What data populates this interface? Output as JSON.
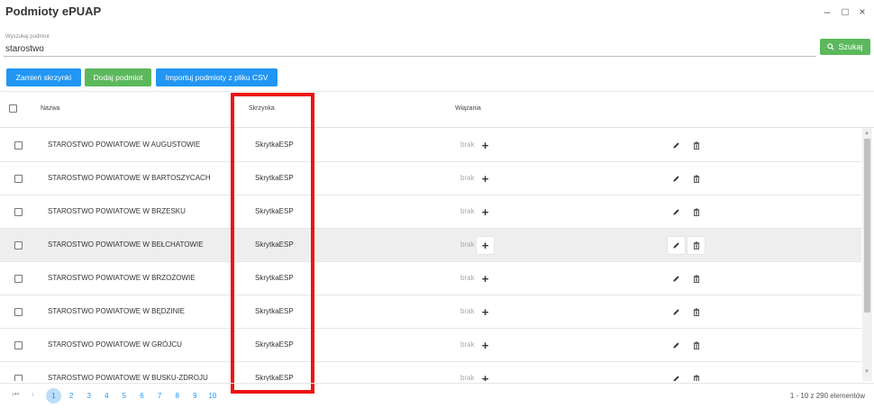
{
  "window": {
    "title": "Podmioty ePUAP",
    "minimize": "–",
    "maximize": "□",
    "close": "×"
  },
  "search": {
    "label": "Wyszukaj podmiot",
    "value": "starostwo",
    "button_label": "Szukaj",
    "button_icon": "search-icon"
  },
  "toolbar": {
    "swap_label": "Zamień skrzynki",
    "add_label": "Dodaj podmiot",
    "import_label": "Importuj podmioty z pliku CSV"
  },
  "columns": {
    "name": "Nazwa",
    "box": "Skrzynka",
    "bindings": "Wiązania"
  },
  "rows": [
    {
      "name": "STAROSTWO POWIATOWE W AUGUSTOWIE",
      "box": "SkrytkaESP",
      "bindings": "brak"
    },
    {
      "name": "STAROSTWO POWIATOWE W BARTOSZYCACH",
      "box": "SkrytkaESP",
      "bindings": "brak"
    },
    {
      "name": "STAROSTWO POWIATOWE W BRZESKU",
      "box": "SkrytkaESP",
      "bindings": "brak"
    },
    {
      "name": "STAROSTWO POWIATOWE W BEŁCHATOWIE",
      "box": "SkrytkaESP",
      "bindings": "brak"
    },
    {
      "name": "STAROSTWO POWIATOWE W BRZOZOWIE",
      "box": "SkrytkaESP",
      "bindings": "brak"
    },
    {
      "name": "STAROSTWO POWIATOWE W BĘDZINIE",
      "box": "SkrytkaESP",
      "bindings": "brak"
    },
    {
      "name": "STAROSTWO POWIATOWE W GRÓJCU",
      "box": "SkrytkaESP",
      "bindings": "brak"
    },
    {
      "name": "STAROSTWO POWIATOWE W BUSKU-ZDROJU",
      "box": "SkrytkaESP",
      "bindings": "brak"
    }
  ],
  "row_actions": {
    "add_binding": "+",
    "edit_icon": "pencil-icon",
    "delete_icon": "trash-icon"
  },
  "pagination": {
    "first": "⏮",
    "prev": "‹",
    "pages": [
      "1",
      "2",
      "3",
      "4",
      "5",
      "6",
      "7",
      "8",
      "9",
      "10"
    ],
    "current": "1",
    "summary": "1 - 10 z 290 elementów"
  },
  "colors": {
    "primary": "#2196f3",
    "success": "#5cb85c",
    "highlight": "#ee1111"
  }
}
